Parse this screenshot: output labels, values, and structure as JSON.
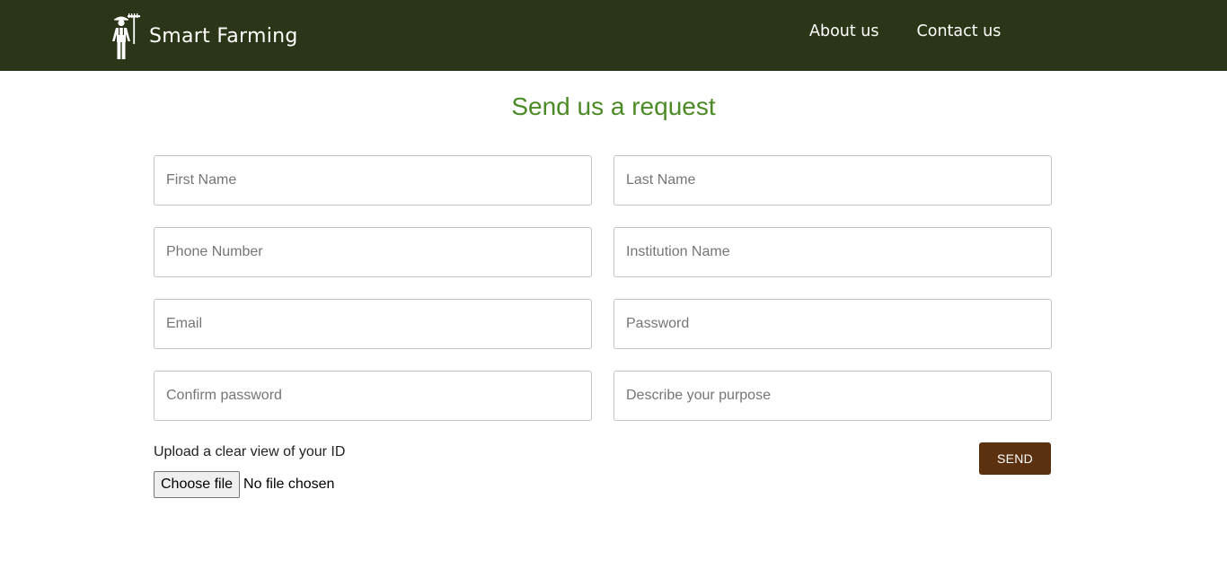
{
  "header": {
    "brand": "Smart Farming",
    "logo_icon": "farmer-icon",
    "nav": [
      {
        "label": "About us"
      },
      {
        "label": "Contact us"
      }
    ],
    "background": "#2b3618"
  },
  "form": {
    "title": "Send us a request",
    "title_color": "#4c8a25",
    "fields": {
      "first_name": {
        "placeholder": "First Name",
        "value": ""
      },
      "last_name": {
        "placeholder": "Last Name",
        "value": ""
      },
      "phone": {
        "placeholder": "Phone Number",
        "value": ""
      },
      "institution": {
        "placeholder": "Institution Name",
        "value": ""
      },
      "email": {
        "placeholder": "Email",
        "value": ""
      },
      "password": {
        "placeholder": "Password",
        "value": ""
      },
      "confirm_password": {
        "placeholder": "Confirm password",
        "value": ""
      },
      "purpose": {
        "placeholder": "Describe your purpose",
        "value": ""
      }
    },
    "upload_label": "Upload a clear view of your ID",
    "choose_file_label": "Choose file",
    "file_status": "No file chosen",
    "send_label": "SEND",
    "send_color": "#5b3110"
  }
}
